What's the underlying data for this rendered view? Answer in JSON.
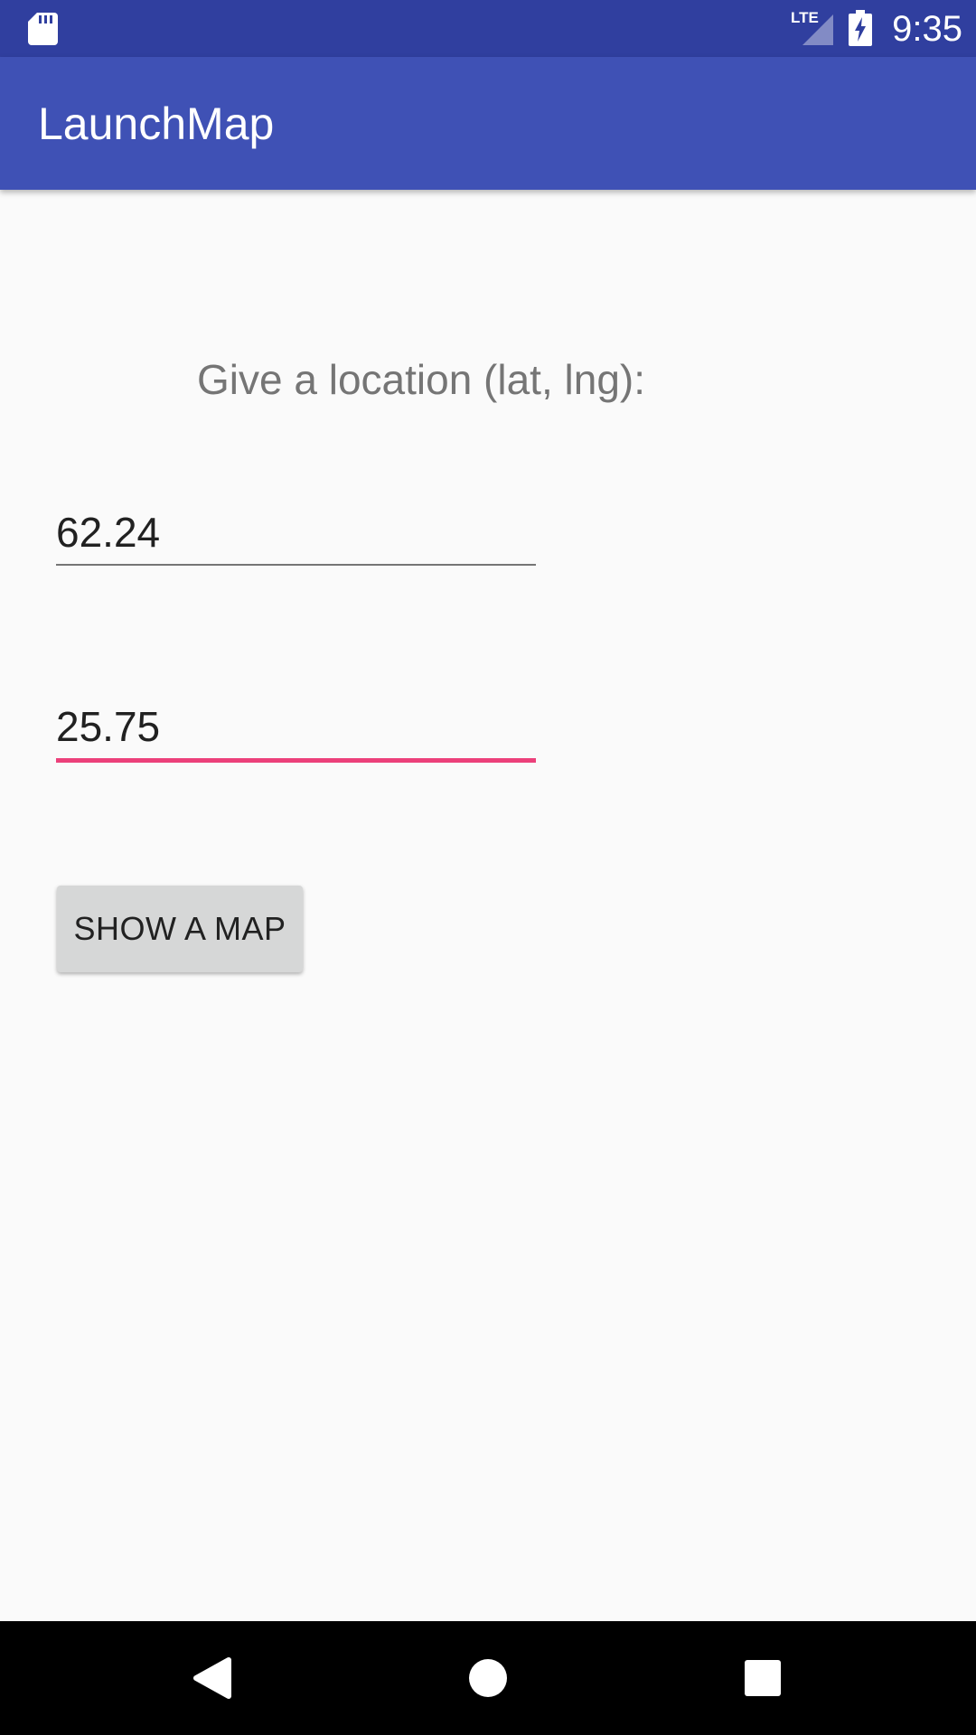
{
  "status_bar": {
    "time": "9:35",
    "network": "LTE",
    "icons": [
      "sd-card-icon",
      "lte-signal-icon",
      "battery-charging-icon"
    ]
  },
  "app_bar": {
    "title": "LaunchMap"
  },
  "form": {
    "prompt": "Give a location (lat, lng):",
    "latitude": "62.24",
    "longitude": "25.75",
    "button_label": "SHOW A MAP"
  },
  "nav_bar": {
    "icons": [
      "back-icon",
      "home-icon",
      "recents-icon"
    ]
  },
  "colors": {
    "status_bar": "#303f9f",
    "app_bar": "#3f51b5",
    "accent": "#ec407a",
    "background": "#fafafa",
    "button": "#d6d7d7"
  }
}
